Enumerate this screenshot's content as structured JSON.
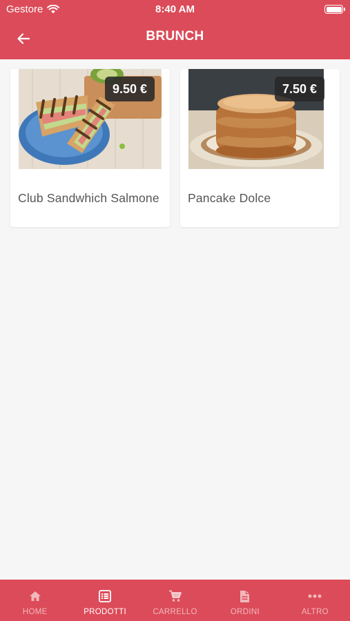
{
  "status_bar": {
    "carrier": "Gestore",
    "time": "8:40 AM"
  },
  "header": {
    "title": "BRUNCH"
  },
  "products": [
    {
      "name": "Club Sandwhich Salmone",
      "price": "9.50 €",
      "image": "club-sandwich-photo"
    },
    {
      "name": "Pancake Dolce",
      "price": "7.50 €",
      "image": "pancake-stack-photo"
    }
  ],
  "tabbar": {
    "items": [
      {
        "label": "HOME",
        "icon": "home-icon"
      },
      {
        "label": "PRODOTTI",
        "icon": "list-icon",
        "active": true
      },
      {
        "label": "CARRELLO",
        "icon": "cart-icon"
      },
      {
        "label": "ORDINI",
        "icon": "document-icon"
      },
      {
        "label": "ALTRO",
        "icon": "more-icon"
      }
    ]
  },
  "colors": {
    "brand": "#dc4b59",
    "background": "#f6f6f6",
    "price_badge": "#282828"
  }
}
